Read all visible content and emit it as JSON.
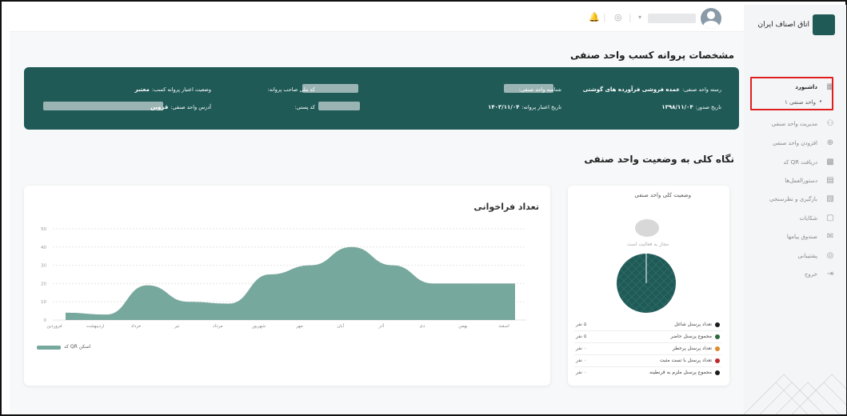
{
  "brand": {
    "logo_text": "اتاق اصناف ایران"
  },
  "sidebar": {
    "items": [
      {
        "label": "داشبورد",
        "icon": "dashboard-icon"
      },
      {
        "label": "واحد صنفی ۱",
        "icon": "dot-icon"
      },
      {
        "label": "مدیریت واحد صنفی",
        "icon": "users-icon"
      },
      {
        "label": "افزودن واحد صنفی",
        "icon": "plus-circle-icon"
      },
      {
        "label": "دریافت QR کد",
        "icon": "qr-icon"
      },
      {
        "label": "دستورالعمل‌ها",
        "icon": "grid-icon"
      },
      {
        "label": "بازگیری و نظرسنجی",
        "icon": "chart-icon"
      },
      {
        "label": "شکایات",
        "icon": "message-icon"
      },
      {
        "label": "صندوق پیامها",
        "icon": "mail-icon"
      },
      {
        "label": "پشتیبانی",
        "icon": "headset-icon"
      },
      {
        "label": "خروج",
        "icon": "logout-icon"
      }
    ]
  },
  "header": {
    "title": "مشخصات پروانه کسب واحد صنفی"
  },
  "license": {
    "type_label": "رسته واحد صنفی:",
    "type_value": "عمده فروشی فرآورده های گوشتی",
    "id_label": "شناسه واحد صنفی:",
    "owner_label": "کد ملی صاحب پروانه:",
    "status_label": "وضعیت اعتبار پروانه کسب:",
    "status_value": "معتبر",
    "issue_label": "تاریخ صدور:",
    "issue_value": "۱۳۹۸/۱۱/۰۴",
    "expiry_label": "تاریخ اعتبار پروانه:",
    "expiry_value": "۱۴۰۳/۱۱/۰۴",
    "postal_label": "کد پستی:",
    "address_label": "آدرس واحد صنفی:",
    "address_value": "قزوین"
  },
  "overview": {
    "title": "نگاه کلی به وضعیت واحد صنفی"
  },
  "status_card": {
    "title": "وضعیت کلی واحد صنفی",
    "subtitle": "مجاز به فعالیت است",
    "legend": [
      {
        "label": "تعداد پرسنل شاغل",
        "value": "۵ نفر",
        "color": "#1b1b1b"
      },
      {
        "label": "مجموع پرسنل حاضر",
        "value": "۵ نفر",
        "color": "#2a6a3a"
      },
      {
        "label": "تعداد پرسنل پرخطر",
        "value": "۰ نفر",
        "color": "#e08a2a"
      },
      {
        "label": "تعداد پرسنل با تست مثبت",
        "value": "۰ نفر",
        "color": "#c02828"
      },
      {
        "label": "مجموع پرسنل ملزم به قرنطینه",
        "value": "۰ نفر",
        "color": "#1b1b1b"
      }
    ]
  },
  "recall_card": {
    "title": "تعداد فراخوانی"
  },
  "chart_data": {
    "type": "area",
    "categories": [
      "فروردین",
      "اردیبهشت",
      "خرداد",
      "تیر",
      "مرداد",
      "شهریور",
      "مهر",
      "آبان",
      "آذر",
      "دی",
      "بهمن",
      "اسفند"
    ],
    "series": [
      {
        "name": "کد QR اسکن",
        "values": [
          4,
          3,
          19,
          10,
          9,
          25,
          30,
          40,
          30,
          20,
          20,
          20
        ]
      }
    ],
    "yticks": [
      0,
      10,
      20,
      30,
      40,
      50
    ],
    "ylim": [
      0,
      50
    ],
    "color": "#77a89d",
    "grid": true
  }
}
